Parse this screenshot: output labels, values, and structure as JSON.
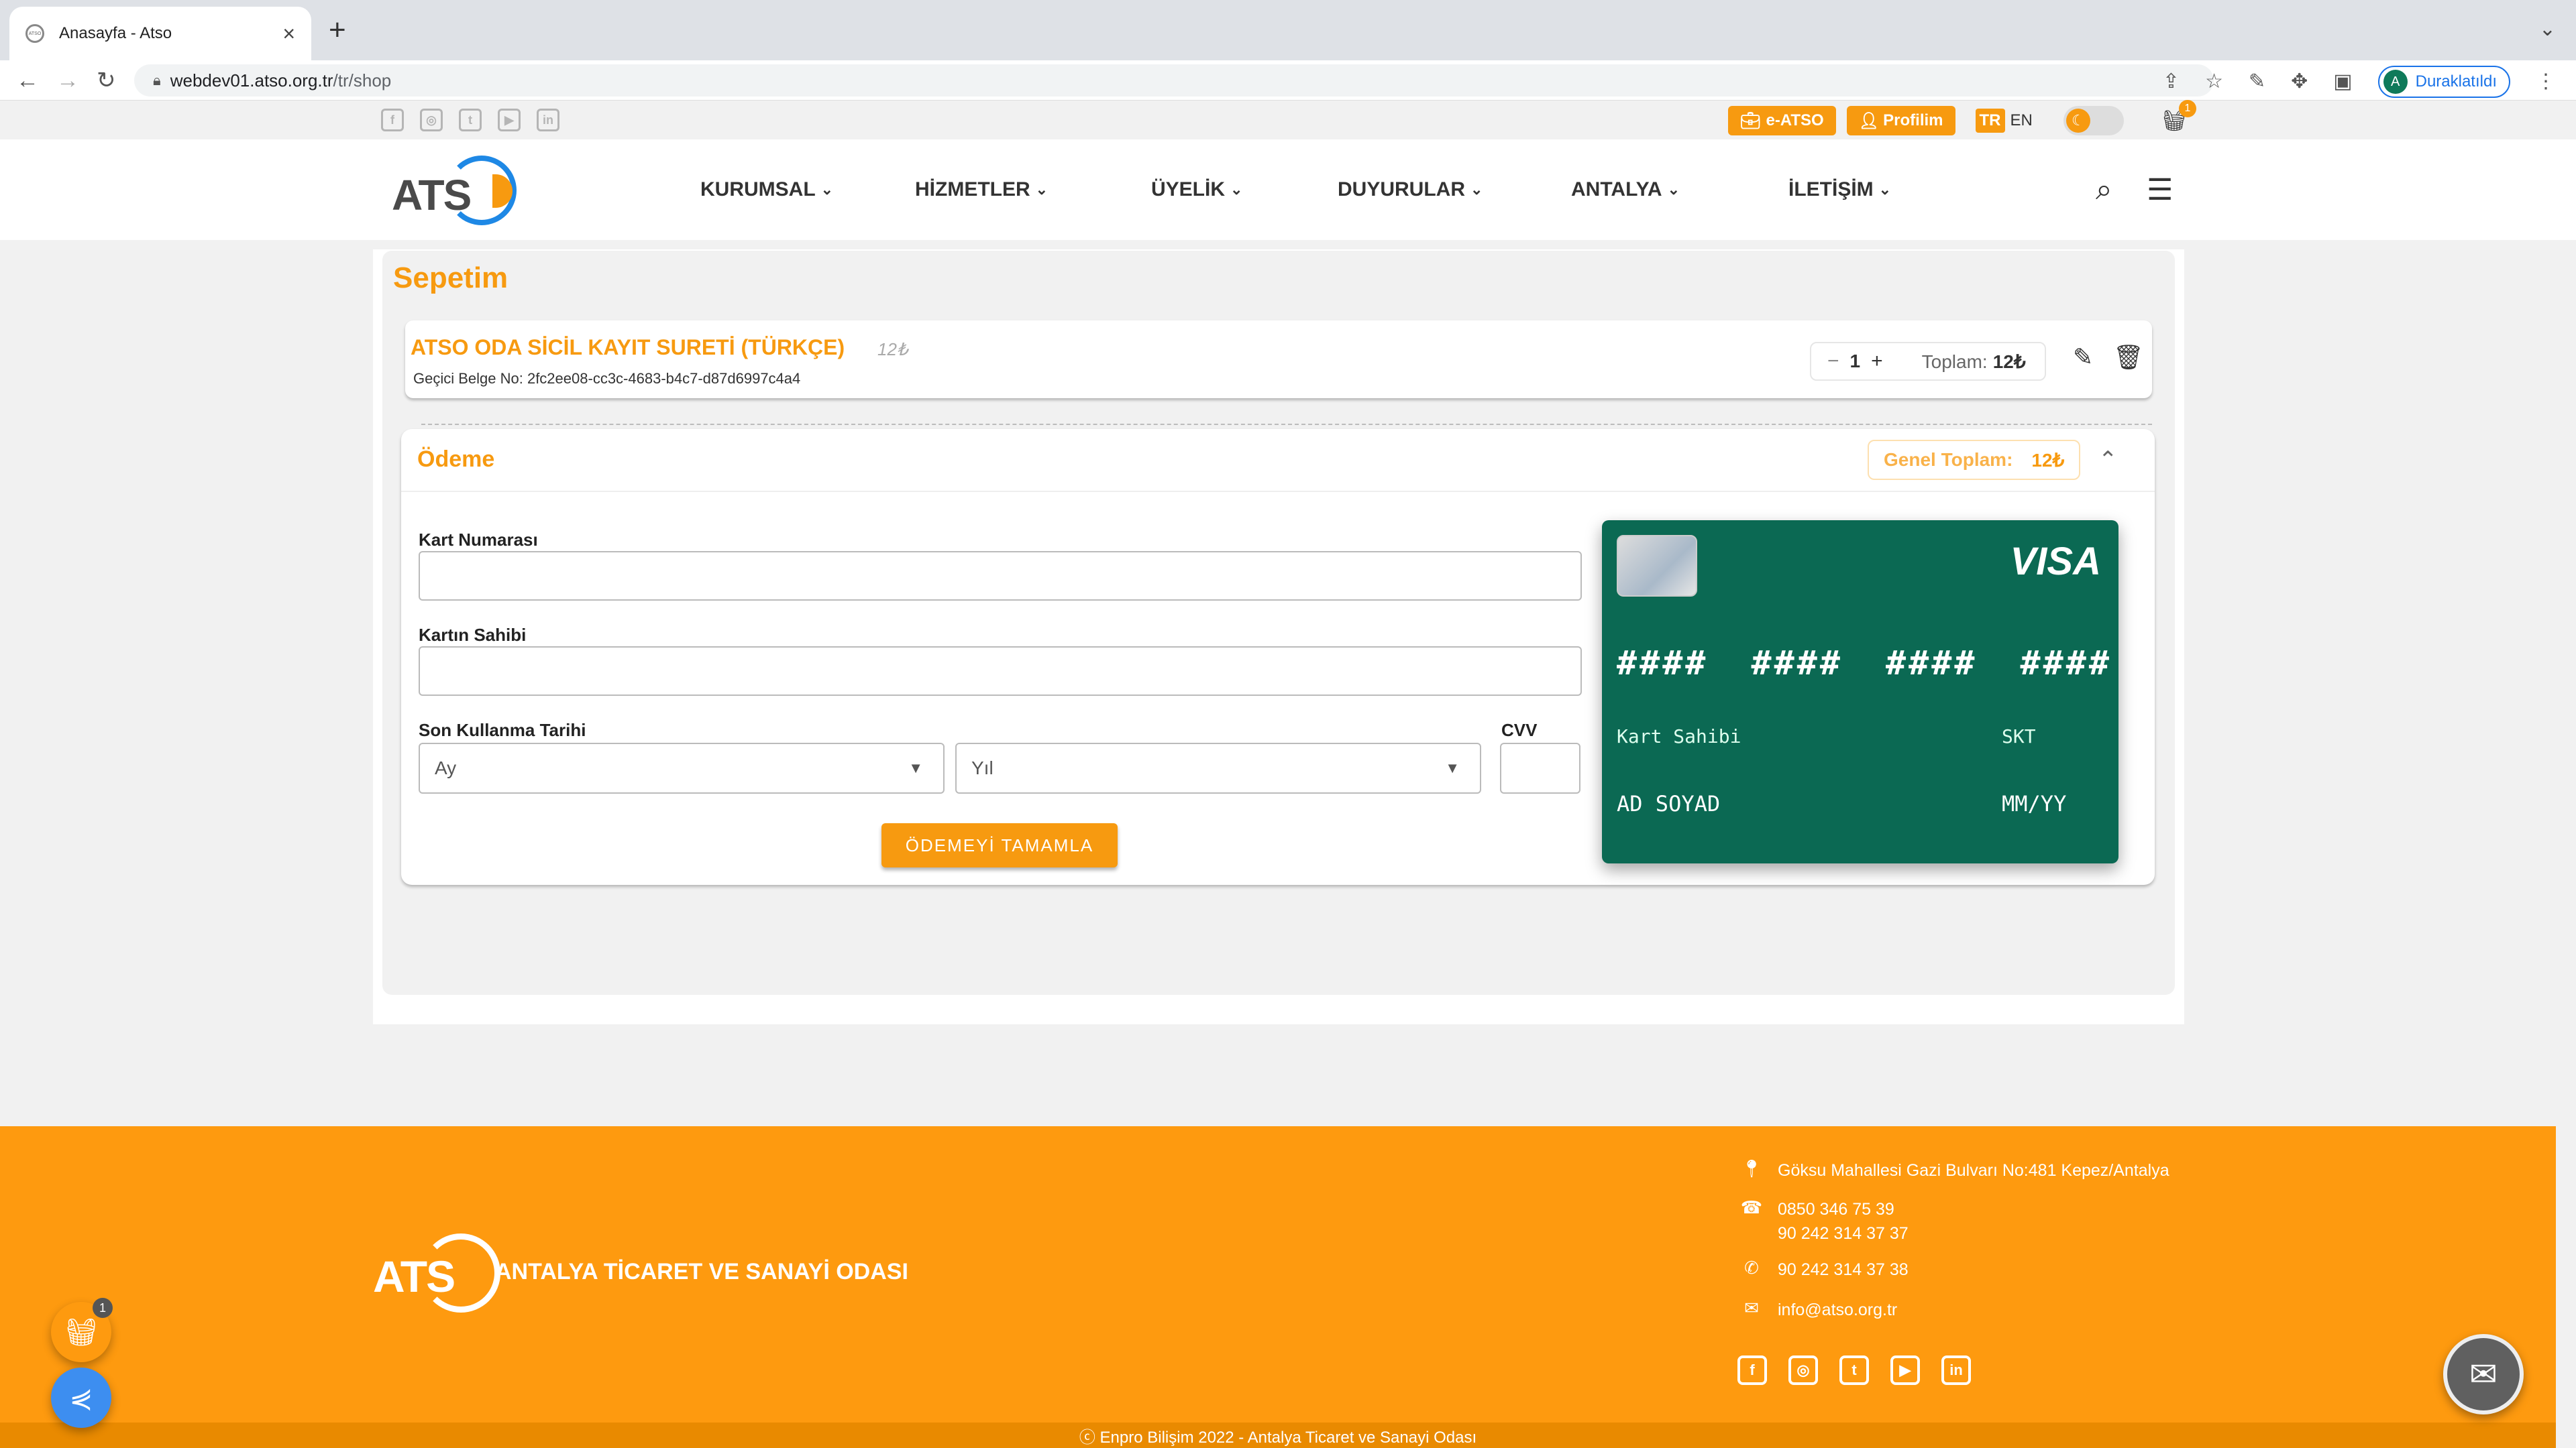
{
  "browser": {
    "tab_title": "Anasayfa - Atso",
    "tab_favicon": "ATSO",
    "url_host": "webdev01.atso.org.tr",
    "url_path": "/tr/shop",
    "profile_initial": "A",
    "profile_label": "Duraklatıldı"
  },
  "topbar": {
    "social": [
      "f",
      "◎",
      "t",
      "▶",
      "in"
    ],
    "eatso_label": "e-ATSO",
    "profile_label": "Profilim",
    "lang_tr": "TR",
    "lang_en": "EN",
    "cart_count": "1"
  },
  "nav": {
    "logo_text": "ATS",
    "items": [
      "KURUMSAL",
      "HİZMETLER",
      "ÜYELİK",
      "DUYURULAR",
      "ANTALYA",
      "İLETİŞİM"
    ]
  },
  "cart": {
    "title": "Sepetim",
    "item": {
      "name": "ATSO ODA SİCİL KAYIT SURETİ (TÜRKÇE)",
      "unit_price": "12₺",
      "temp_doc": "Geçici Belge No: 2fc2ee08-cc3c-4683-b4c7-d87d6997c4a4",
      "qty": "1",
      "total_label": "Toplam:",
      "total_value": "12₺"
    }
  },
  "payment": {
    "title": "Ödeme",
    "grand_total_label": "Genel Toplam:",
    "grand_total_value": "12₺",
    "card_number_label": "Kart Numarası",
    "card_holder_label": "Kartın Sahibi",
    "expiry_label": "Son Kullanma Tarihi",
    "cvv_label": "CVV",
    "month_placeholder": "Ay",
    "year_placeholder": "Yıl",
    "submit_label": "ÖDEMEYİ TAMAMLA"
  },
  "card_preview": {
    "brand": "VISA",
    "number": "#### #### #### ####",
    "holder_label": "Kart Sahibi",
    "expiry_label": "SKT",
    "holder_value": "AD SOYAD",
    "expiry_value": "MM/YY",
    "color": "#0b6953"
  },
  "footer": {
    "org_name": "ANTALYA TİCARET VE SANAYİ ODASI",
    "address": "Göksu Mahallesi Gazi Bulvarı No:481 Kepez/Antalya",
    "phone1": "0850 346 75 39",
    "phone2": "90 242 314 37 37",
    "fax": "90 242 314 37 38",
    "email": "info@atso.org.tr",
    "social": [
      "f",
      "◎",
      "t",
      "▶",
      "in"
    ],
    "copyright": "ⓒ Enpro Bilişim 2022 - Antalya Ticaret ve Sanayi Odası"
  },
  "floating": {
    "cart_badge": "1"
  },
  "colors": {
    "brand_orange": "#f79a10",
    "footer_orange": "#fe9a0f",
    "card_green": "#0b6953",
    "share_blue": "#3d8ef0"
  }
}
